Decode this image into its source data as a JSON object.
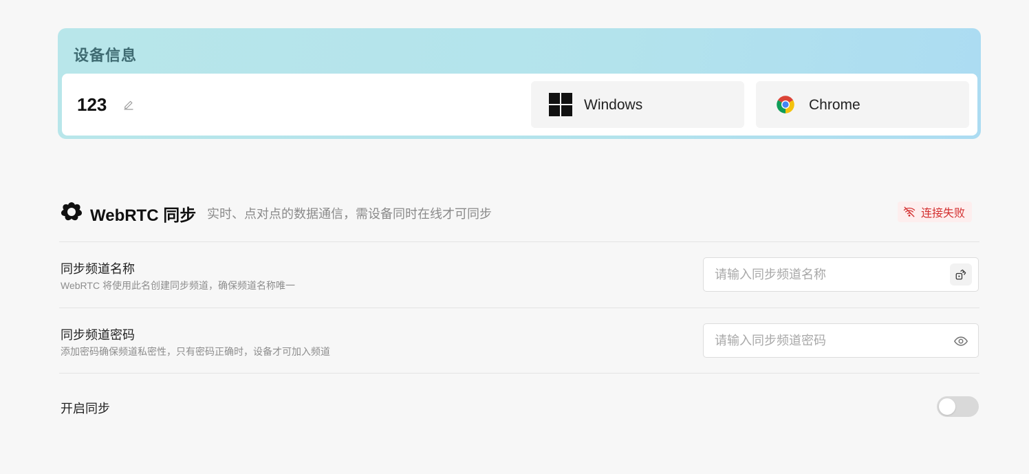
{
  "device_info": {
    "title": "设备信息",
    "device_name": "123",
    "os": {
      "label": "Windows",
      "icon": "windows-icon"
    },
    "browser": {
      "label": "Chrome",
      "icon": "chrome-icon"
    }
  },
  "webrtc": {
    "title": "WebRTC 同步",
    "description": "实时、点对点的数据通信，需设备同时在线才可同步",
    "status": {
      "label": "连接失败",
      "icon": "wifi-off-icon",
      "color": "#d32f2f"
    }
  },
  "settings": {
    "channel_name": {
      "label": "同步频道名称",
      "hint": "WebRTC 将使用此名创建同步频道，确保频道名称唯一",
      "placeholder": "请输入同步频道名称",
      "value": ""
    },
    "channel_password": {
      "label": "同步频道密码",
      "hint": "添加密码确保频道私密性，只有密码正确时，设备才可加入频道",
      "placeholder": "请输入同步频道密码",
      "value": ""
    },
    "enable_sync": {
      "label": "开启同步",
      "enabled": false
    }
  }
}
